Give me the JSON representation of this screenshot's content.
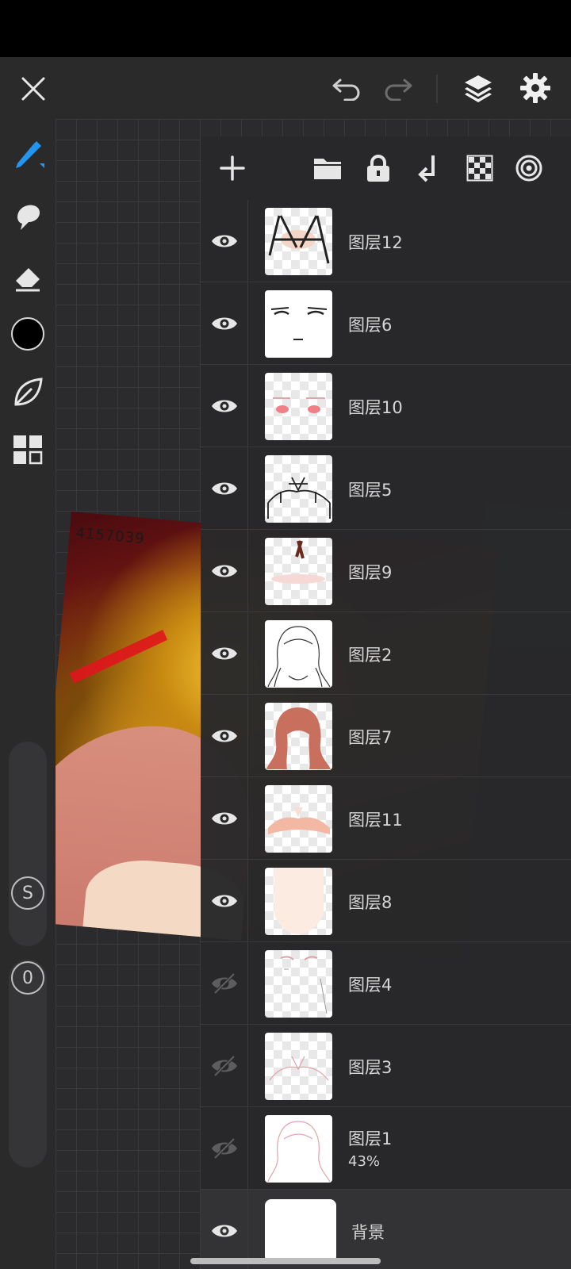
{
  "colors": {
    "accent": "#2196f3",
    "current_color": "#000000",
    "icon": "#e6e6e6",
    "icon_disabled": "#7a7a7a"
  },
  "left_toolbar": {
    "size_slider_label": "S",
    "opacity_slider_label": "0"
  },
  "artwork": {
    "overlay_text": "4157039"
  },
  "layers": [
    {
      "name": "图层12",
      "visible": true
    },
    {
      "name": "图层6",
      "visible": true
    },
    {
      "name": "图层10",
      "visible": true
    },
    {
      "name": "图层5",
      "visible": true
    },
    {
      "name": "图层9",
      "visible": true
    },
    {
      "name": "图层2",
      "visible": true
    },
    {
      "name": "图层7",
      "visible": true
    },
    {
      "name": "图层11",
      "visible": true
    },
    {
      "name": "图层8",
      "visible": true
    },
    {
      "name": "图层4",
      "visible": false
    },
    {
      "name": "图层3",
      "visible": false
    },
    {
      "name": "图层1",
      "visible": false,
      "opacity": "43%"
    }
  ],
  "background_layer": {
    "name": "背景",
    "visible": true
  }
}
